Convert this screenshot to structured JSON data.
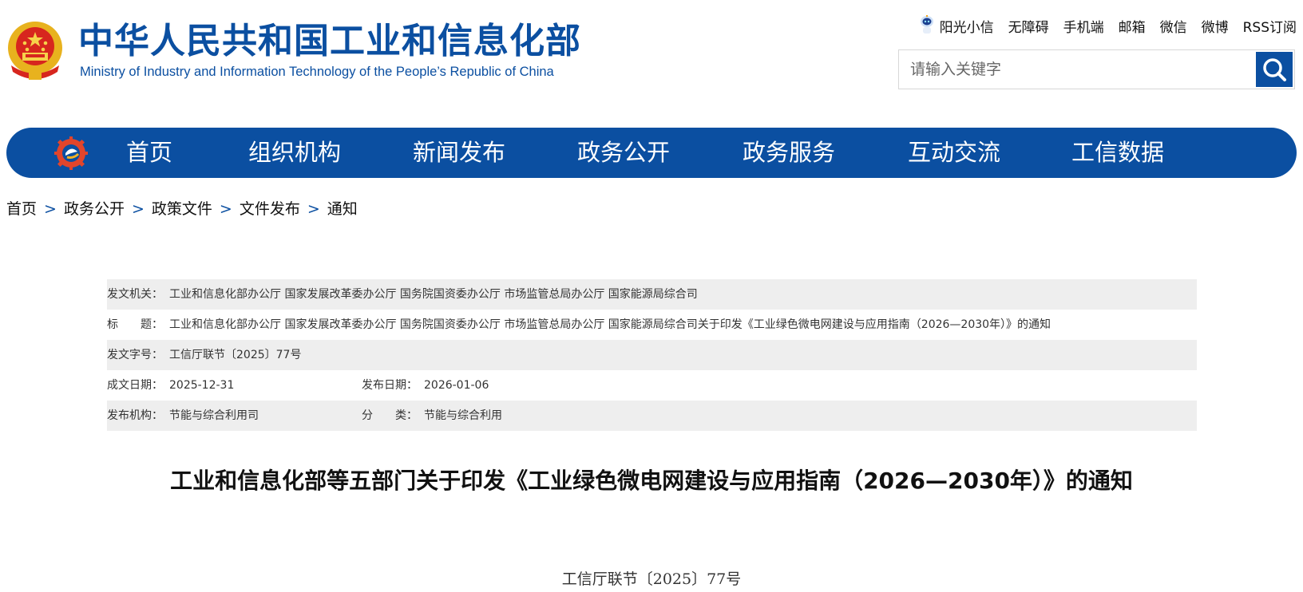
{
  "header": {
    "title": "中华人民共和国工业和信息化部",
    "subtitle": "Ministry of Industry and Information Technology of the People’s Republic of China"
  },
  "toplinks": [
    "阳光小信",
    "无障碍",
    "手机端",
    "邮箱",
    "微信",
    "微博",
    "RSS订阅"
  ],
  "search": {
    "placeholder": "请输入关键字"
  },
  "nav": [
    "首页",
    "组织机构",
    "新闻发布",
    "政务公开",
    "政务服务",
    "互动交流",
    "工信数据"
  ],
  "breadcrumb": {
    "items": [
      "首页",
      "政务公开",
      "政策文件",
      "文件发布",
      "通知"
    ],
    "separator": ">"
  },
  "info": {
    "issuer_label": "发文机关：",
    "issuer": "工业和信息化部办公厅 国家发展改革委办公厅 国务院国资委办公厅 市场监管总局办公厅 国家能源局综合司",
    "title_label": "标　　题：",
    "title": "工业和信息化部办公厅 国家发展改革委办公厅 国务院国资委办公厅 市场监管总局办公厅 国家能源局综合司关于印发《工业绿色微电网建设与应用指南（2026—2030年）》的通知",
    "docno_label": "发文字号：",
    "docno": "工信厅联节〔2025〕77号",
    "written_label": "成文日期：",
    "written": "2025-12-31",
    "published_label": "发布日期：",
    "published": "2026-01-06",
    "org_label": "发布机构：",
    "org": "节能与综合利用司",
    "category_label": "分　　类：",
    "category": "节能与综合利用"
  },
  "article": {
    "title": "工业和信息化部等五部门关于印发《工业绿色微电网建设与应用指南（2026—2030年）》的通知",
    "doc_number": "工信厅联节〔2025〕77号"
  },
  "colors": {
    "brand_blue": "#0b4fa1",
    "row_shade": "#eeeeee"
  }
}
